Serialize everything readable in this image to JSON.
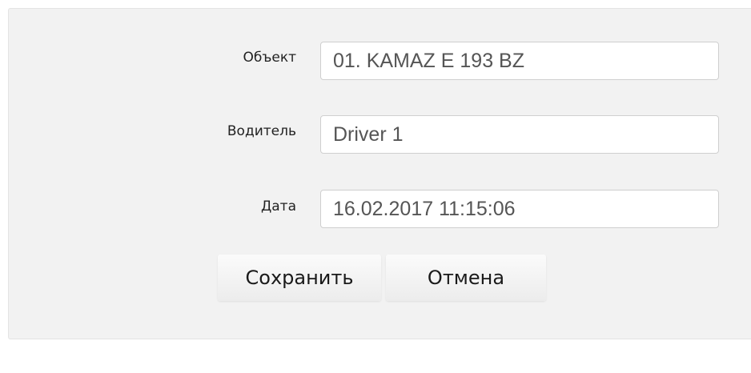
{
  "form": {
    "object_label": "Объект",
    "object_value": "01. KAMAZ E 193 BZ",
    "driver_label": "Водитель",
    "driver_value": "Driver 1",
    "date_label": "Дата",
    "date_value": "16.02.2017 11:15:06"
  },
  "actions": {
    "save_label": "Сохранить",
    "cancel_label": "Отмена"
  }
}
